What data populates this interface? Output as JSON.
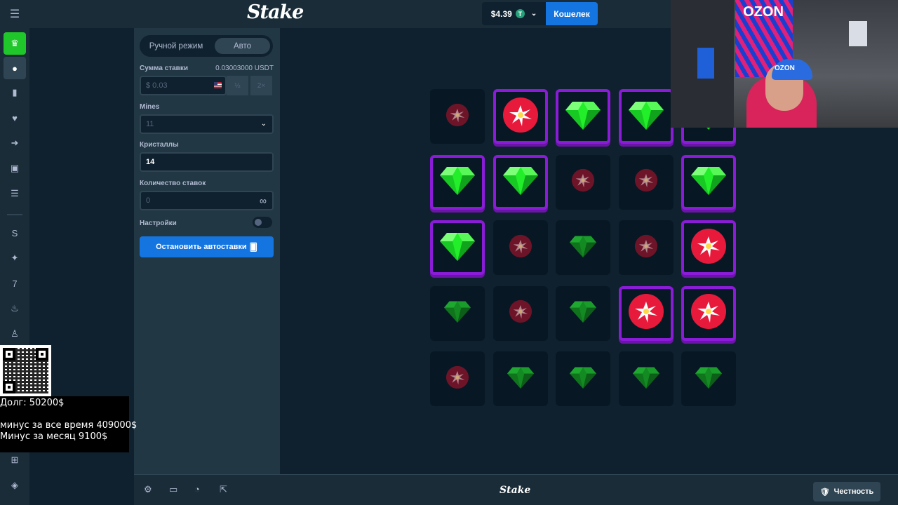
{
  "header": {
    "logo": "Stake",
    "balance": "$4.39",
    "currency_symbol": "T",
    "wallet_button": "Кошелек"
  },
  "sidebar_icons": [
    "menu-icon",
    "casino-icon",
    "sports-icon",
    "bookmark-icon",
    "heart-icon",
    "arrow-right-icon",
    "cards-icon",
    "list-icon",
    "stake-originals-icon",
    "sparkle-icon",
    "seven-icon",
    "fire-icon",
    "shirt-icon",
    "gift-icon",
    "game-icon"
  ],
  "panel": {
    "mode_manual": "Ручной режим",
    "mode_auto": "Авто",
    "bet_label": "Сумма ставки",
    "bet_usdt": "0.03003000 USDT",
    "bet_value": "$ 0.03",
    "half": "½",
    "double": "2×",
    "mines_label": "Mines",
    "mines_value": "11",
    "crystals_label": "Кристаллы",
    "crystals_value": "14",
    "bets_count_label": "Количество ставок",
    "bets_count_value": "0",
    "infinity": "∞",
    "settings_label": "Настройки",
    "stop_button": "Остановить автоставки"
  },
  "grid": {
    "rows": 5,
    "cols": 5,
    "tiles": [
      [
        "mine",
        "MINE",
        "GEM",
        "GEM",
        "GEM"
      ],
      [
        "GEM",
        "GEM",
        "mine",
        "mine",
        "GEM"
      ],
      [
        "GEM",
        "mine",
        "gem",
        "mine",
        "MINE"
      ],
      [
        "gem",
        "mine",
        "gem",
        "MINE",
        "MINE"
      ],
      [
        "mine",
        "gem",
        "gem",
        "gem",
        "gem"
      ]
    ],
    "legend": "uppercase = revealed/selected tile, lowercase = unrevealed outcome"
  },
  "footer": {
    "logo": "Stake",
    "fairness_button": "Честность",
    "icons": [
      "settings-icon",
      "theater-mode-icon",
      "stats-icon",
      "popout-icon"
    ]
  },
  "overlay": {
    "debt": "Долг: 50200$",
    "total_minus": "минус за все время 409000$",
    "month_minus": "Минус за месяц 9100$"
  },
  "webcam": {
    "wall_text": "OZON",
    "cap_text": "OZON"
  },
  "colors": {
    "background": "#0f212e",
    "panel": "#213743",
    "accent_blue": "#1475e1",
    "gem_green": "#1fe02a",
    "mine_red": "#e01a3a",
    "tile_border": "#8a1cd8"
  }
}
